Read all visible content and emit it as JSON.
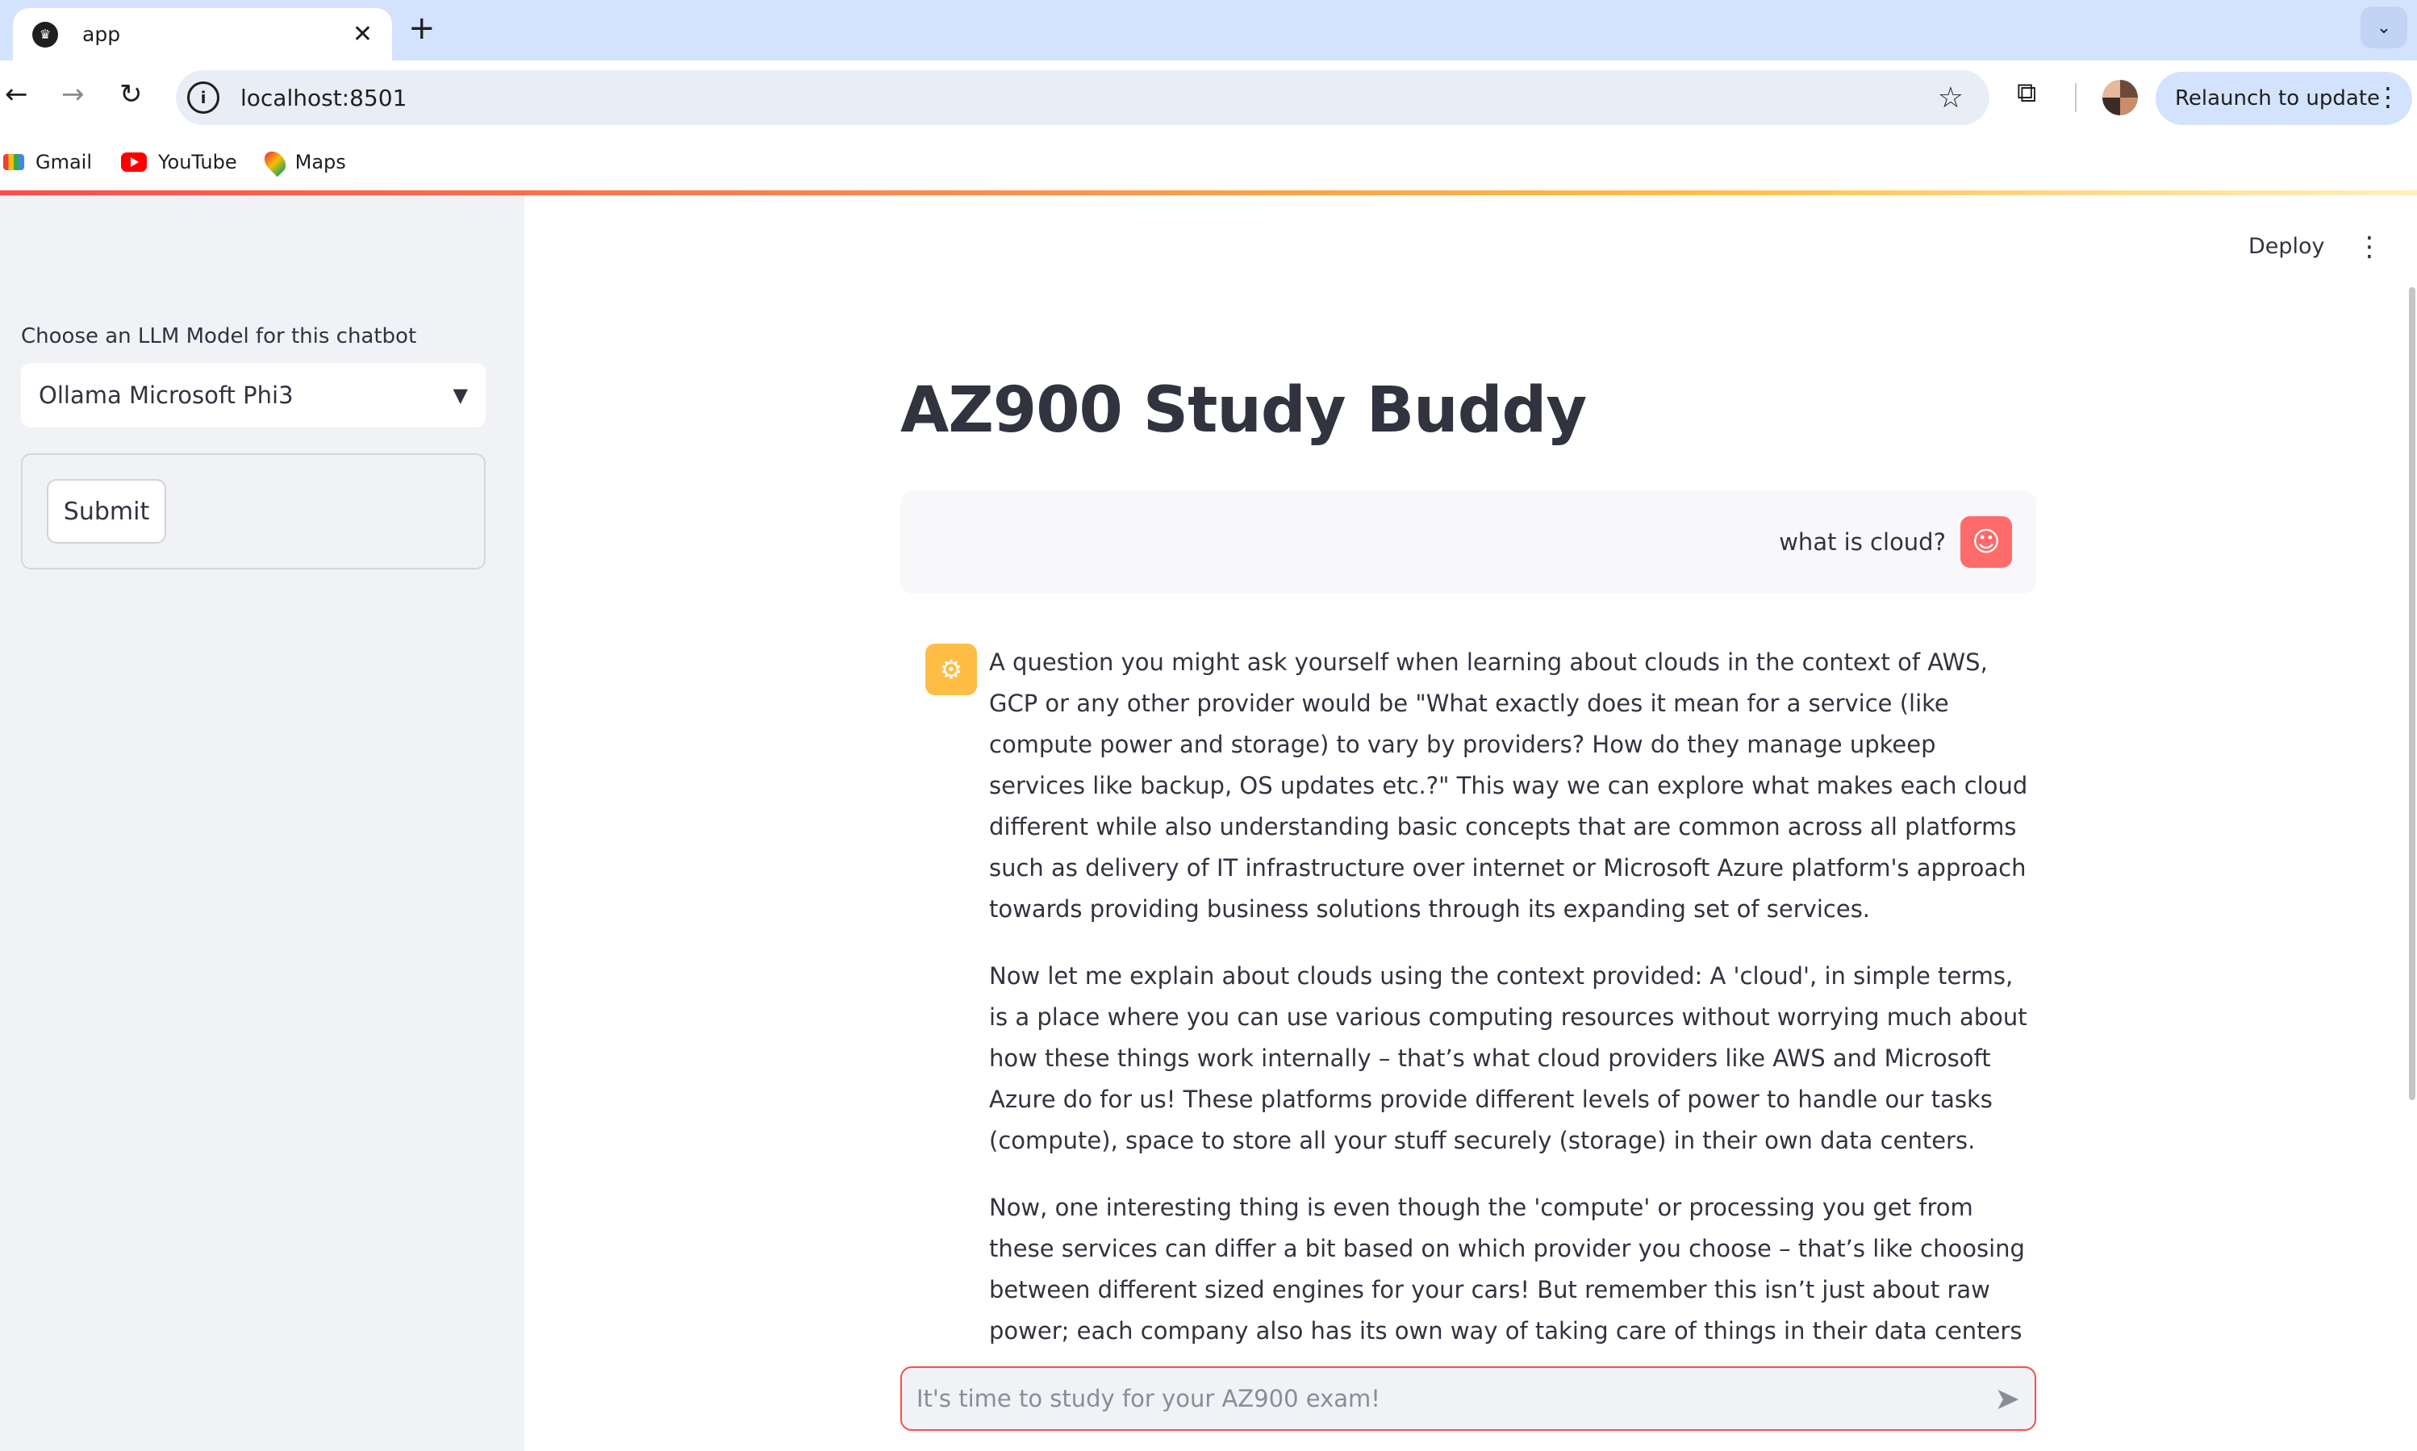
{
  "browser": {
    "tab_title": "app",
    "new_tab": "+",
    "url": "localhost:8501",
    "relaunch_label": "Relaunch to update",
    "bookmarks": [
      {
        "label": "Gmail",
        "icon": "gmail-icon"
      },
      {
        "label": "YouTube",
        "icon": "youtube-icon"
      },
      {
        "label": "Maps",
        "icon": "maps-icon"
      }
    ]
  },
  "header": {
    "deploy_label": "Deploy"
  },
  "sidebar": {
    "model_label": "Choose an LLM Model for this chatbot",
    "model_selected": "Ollama Microsoft Phi3",
    "submit_label": "Submit"
  },
  "main": {
    "title": "AZ900 Study Buddy",
    "user_message": "what is cloud?",
    "assistant_paragraphs": [
      "A question you might ask yourself when learning about clouds in the context of AWS, GCP or any other provider would be \"What exactly does it mean for a service (like compute power and storage) to vary by providers? How do they manage upkeep services like backup, OS updates etc.?\" This way we can explore what makes each cloud different while also understanding basic concepts that are common across all platforms such as delivery of IT infrastructure over internet or Microsoft Azure platform's approach towards providing business solutions through its expanding set of services.",
      "Now let me explain about clouds using the context provided: A 'cloud', in simple terms, is a place where you can use various computing resources without worrying much about how these things work internally – that’s what cloud providers like AWS and Microsoft Azure do for us! These platforms provide different levels of power to handle our tasks (compute), space to store all your stuff securely (storage) in their own data centers.",
      "Now, one interesting thing is even though the 'compute' or processing you get from these services can differ a bit based on which provider you choose – that’s like choosing between different sized engines for your cars! But remember this isn’t just about raw power; each company also has its own way of taking care of things in their data centers (this is what we call"
    ],
    "chat_placeholder": "It's time to study for your AZ900 exam!"
  },
  "colors": {
    "accent": "#ff4b4b",
    "user_avatar": "#ff6b6b",
    "assistant_avatar": "#ffbd45",
    "sidebar_bg": "#f0f2f6"
  }
}
